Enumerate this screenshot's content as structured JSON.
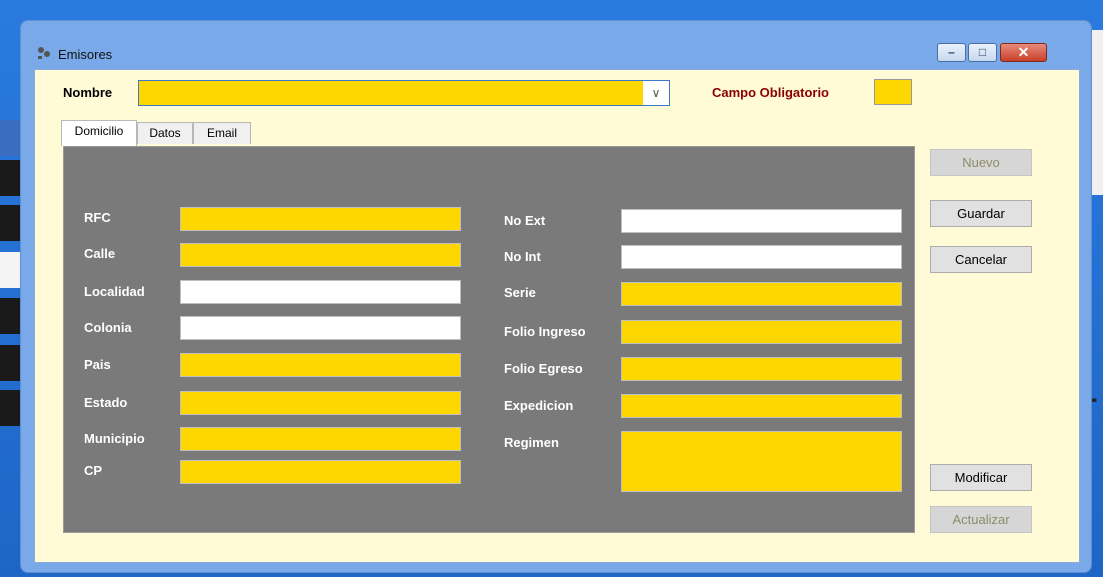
{
  "window": {
    "title": "Emisores",
    "controls": {
      "minimize": "–",
      "maximize": "□",
      "close": "✕"
    }
  },
  "header": {
    "nombre_label": "Nombre",
    "nombre_value": "",
    "dropdown_arrow": "∨",
    "obligatorio_label": "Campo Obligatorio"
  },
  "tabs": [
    {
      "label": "Domicilio",
      "active": true
    },
    {
      "label": "Datos",
      "active": false
    },
    {
      "label": "Email",
      "active": false
    }
  ],
  "form_left": [
    {
      "label": "RFC",
      "value": "",
      "required": true
    },
    {
      "label": "Calle",
      "value": "",
      "required": true
    },
    {
      "label": "Localidad",
      "value": "",
      "required": false
    },
    {
      "label": "Colonia",
      "value": "",
      "required": false
    },
    {
      "label": "Pais",
      "value": "",
      "required": true
    },
    {
      "label": "Estado",
      "value": "",
      "required": true
    },
    {
      "label": "Municipio",
      "value": "",
      "required": true
    },
    {
      "label": "CP",
      "value": "",
      "required": true
    }
  ],
  "form_right": [
    {
      "label": "No Ext",
      "value": "",
      "required": false
    },
    {
      "label": "No Int",
      "value": "",
      "required": false
    },
    {
      "label": "Serie",
      "value": "",
      "required": true
    },
    {
      "label": "Folio Ingreso",
      "value": "",
      "required": true
    },
    {
      "label": "Folio Egreso",
      "value": "",
      "required": true
    },
    {
      "label": "Expedicion",
      "value": "",
      "required": true
    },
    {
      "label": "Regimen",
      "value": "",
      "required": true
    }
  ],
  "buttons": {
    "nuevo": {
      "label": "Nuevo",
      "enabled": false
    },
    "guardar": {
      "label": "Guardar",
      "enabled": true
    },
    "cancelar": {
      "label": "Cancelar",
      "enabled": true
    },
    "modificar": {
      "label": "Modificar",
      "enabled": true
    },
    "actualizar": {
      "label": "Actualizar",
      "enabled": false
    }
  },
  "colors": {
    "required_field": "#ffd700",
    "optional_field": "#ffffff",
    "panel_bg": "#7a7a7a",
    "form_bg": "#fffbd6",
    "required_label": "#8b0000"
  },
  "background": {
    "partial_text": "r"
  }
}
